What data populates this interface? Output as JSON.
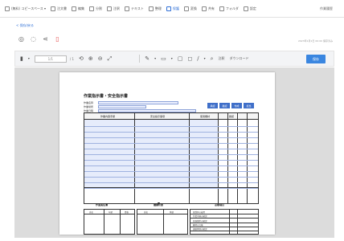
{
  "menubar": {
    "items": [
      {
        "label": "(無料) コピースペース ▾",
        "active": false
      },
      {
        "label": "注文書",
        "active": false
      },
      {
        "label": "編集",
        "active": false
      },
      {
        "label": "分割",
        "active": false
      },
      {
        "label": "注釈",
        "active": false
      },
      {
        "label": "テキスト",
        "active": false
      },
      {
        "label": "整理",
        "active": false
      },
      {
        "label": "保護",
        "active": true
      },
      {
        "label": "変換",
        "active": false
      },
      {
        "label": "共有",
        "active": false
      },
      {
        "label": "フォルダ",
        "active": false
      },
      {
        "label": "設定",
        "active": false
      }
    ],
    "right_text": "作業履歴"
  },
  "breadcrumb": "< 保存/戻る",
  "actions": {
    "icons": [
      "eye-icon",
      "comment-icon",
      "share-icon",
      "trash-icon"
    ],
    "timestamp": "2023年1月1日 00:00 保存済み"
  },
  "viewer_toolbar": {
    "page_input": "1/1",
    "page_total": "/ 1",
    "stamp_label": "注釈",
    "download_label": "ダウンロード",
    "save_label": "保存"
  },
  "document": {
    "title": "作業指示書・安全指示書",
    "meta_labels": [
      "作業名称",
      "作業場所",
      "作業日時"
    ],
    "header_buttons": [
      "承認",
      "確認",
      "作成",
      "担当"
    ],
    "grid_headers": [
      "作業内容手順",
      "安全指示事項",
      "使用機材",
      "確認"
    ],
    "bottom_sections": [
      {
        "label": "作業員名簿",
        "cols": [
          "氏名",
          "年齢",
          "資格"
        ]
      },
      {
        "label": "健康状態",
        "cols": [
          "氏名",
          "体調"
        ]
      },
      {
        "label": "点検項目",
        "cols": [
          "項目",
          "確認"
        ]
      }
    ],
    "check_items": [
      "保護具の着用",
      "作業手順の確認",
      "危険箇所の確認",
      "機材の点検",
      "連絡体制の確認"
    ]
  }
}
